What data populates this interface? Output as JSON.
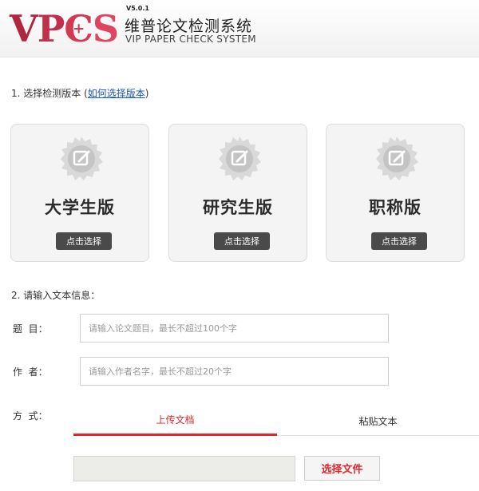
{
  "header": {
    "logo": {
      "v": "V",
      "p": "P",
      "c": "C",
      "plus": "+",
      "s": "S"
    },
    "version": "V5.0.1",
    "title": "维普论文检测系统",
    "subtitle": "VIP PAPER CHECK SYSTEM"
  },
  "section1": {
    "title": "1. 选择检测版本 (",
    "link": "如何选择版本",
    "close_paren": ")",
    "cards": [
      {
        "title": "大学生版",
        "button": "点击选择"
      },
      {
        "title": "研究生版",
        "button": "点击选择"
      },
      {
        "title": "职称版",
        "button": "点击选择"
      }
    ]
  },
  "section2": {
    "title": "2. 请输入文本信息：",
    "title_field": {
      "label": "题  目：",
      "placeholder": "请输入论文题目，最长不超过100个字"
    },
    "author_field": {
      "label": "作  者：",
      "placeholder": "请输入作者名字，最长不超过20个字"
    },
    "method_label": "方  式：",
    "tabs": [
      {
        "label": "上传文档",
        "active": true
      },
      {
        "label": "粘贴文本",
        "active": false
      }
    ],
    "file_button": "选择文件"
  },
  "colors": {
    "accent": "#e0282f",
    "logo": "#c0304a",
    "link": "#1a56c4",
    "button": "#4a4a4a"
  }
}
